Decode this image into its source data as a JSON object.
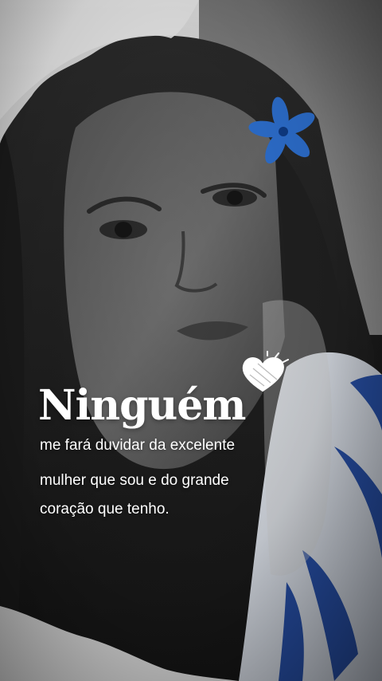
{
  "story": {
    "headline": "Ninguém",
    "lines": [
      "me fará duvidar da excelente",
      "mulher que sou e do grande",
      "coração que tenho."
    ]
  },
  "colors": {
    "flower": "#2f74d8",
    "shirt_blue": "#1f4aa8",
    "text": "#ffffff"
  },
  "icons": [
    "heart-doodle-icon",
    "flower-icon"
  ]
}
